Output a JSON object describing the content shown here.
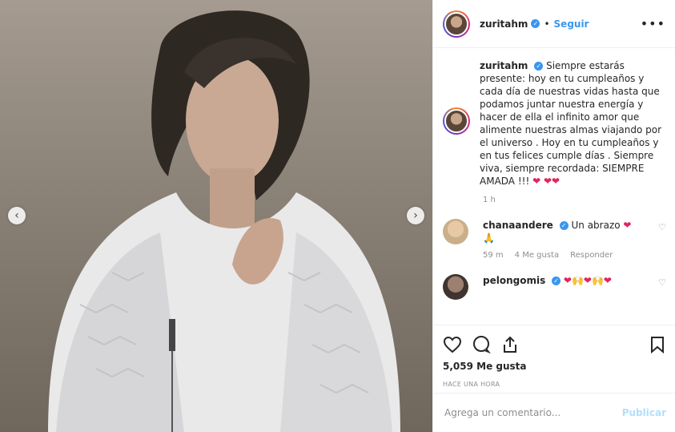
{
  "post": {
    "image_alt": "Mujer con cabello corto oscuro y chaqueta blanca con textura de flecos",
    "prev_icon": "chevron-left-icon",
    "next_icon": "chevron-right-icon"
  },
  "header": {
    "username": "zuritahm",
    "separator": "•",
    "follow_label": "Seguir",
    "more_icon": "•••"
  },
  "caption": {
    "username": "zuritahm",
    "text": "Siempre estarás presente: hoy en tu cumpleaños y cada día de nuestras vidas hasta que podamos juntar nuestra energía y hacer de ella el infinito amor que alimente nuestras almas viajando por el universo . Hoy en tu cumpleaños y en tus felices cumple días . Siempre viva, siempre recordada: SIEMPRE AMADA !!!",
    "emoji": "❤ ❤❤",
    "time": "1 h"
  },
  "comments": [
    {
      "username": "chanaandere",
      "text": "Un abrazo",
      "emoji": "❤ 🙏",
      "time": "59 m",
      "likes": "4 Me gusta",
      "reply": "Responder"
    },
    {
      "username": "pelongomis",
      "text": "",
      "emoji": "❤🙌❤🙌❤",
      "time": "",
      "likes": "",
      "reply": ""
    }
  ],
  "actions": {
    "likes": "5,059 Me gusta",
    "time": "HACE UNA HORA"
  },
  "add_comment": {
    "placeholder": "Agrega un comentario...",
    "publish_label": "Publicar"
  },
  "colors": {
    "accent": "#3897f0",
    "heart": "#e0245e",
    "muted": "#8e8e8e",
    "publish_disabled": "#b2dffc"
  }
}
